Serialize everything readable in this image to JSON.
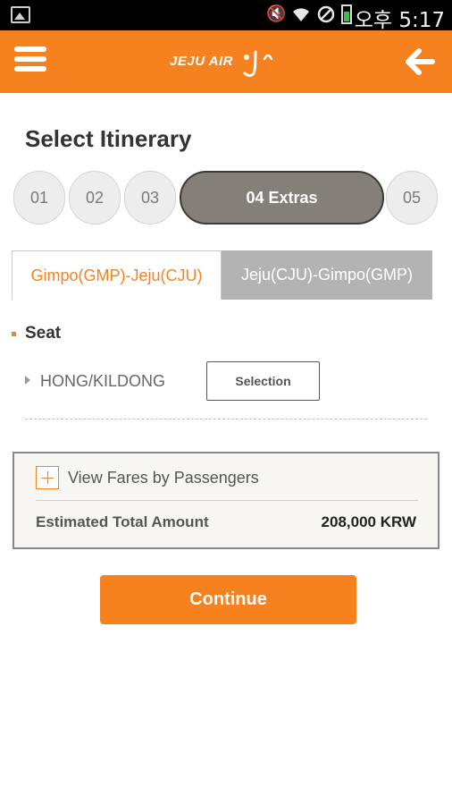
{
  "status_bar": {
    "time": "오후 5:17",
    "icons": [
      "image-icon",
      "mute-icon",
      "wifi-icon",
      "blocked-icon",
      "battery-icon"
    ]
  },
  "header": {
    "logo_text": "JEJU AIR",
    "menu_icon": "hamburger-menu-icon",
    "back_icon": "back-arrow-icon",
    "brand_color": "#f5821f"
  },
  "page": {
    "title": "Select Itinerary"
  },
  "steps": [
    {
      "label": "01",
      "active": false
    },
    {
      "label": "02",
      "active": false
    },
    {
      "label": "03",
      "active": false
    },
    {
      "label": "04 Extras",
      "active": true
    },
    {
      "label": "05",
      "active": false
    }
  ],
  "route_tabs": [
    {
      "label": "Gimpo(GMP)-Jeju(CJU)",
      "active": true
    },
    {
      "label": "Jeju(CJU)-Gimpo(GMP)",
      "active": false
    }
  ],
  "seat_section": {
    "title": "Seat",
    "passenger_name": "HONG/KILDONG",
    "selection_label": "Selection"
  },
  "fare_box": {
    "toggle_label": "View Fares by Passengers",
    "total_label": "Estimated Total Amount",
    "total_value": "208,000 KRW"
  },
  "continue_label": "Continue"
}
